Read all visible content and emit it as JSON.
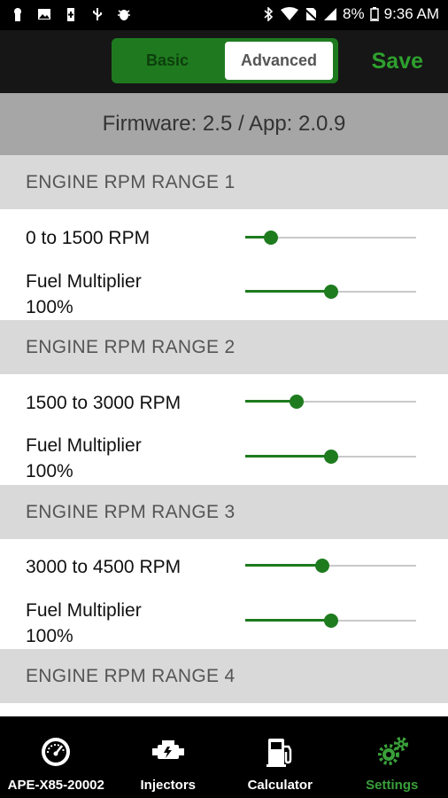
{
  "status_bar": {
    "battery": "8%",
    "time": "9:36 AM"
  },
  "toolbar": {
    "toggle_basic": "Basic",
    "toggle_advanced": "Advanced",
    "selected_mode": "Advanced",
    "save_label": "Save"
  },
  "firmware_text": "Firmware: 2.5 / App: 2.0.9",
  "sections": [
    {
      "header": "ENGINE RPM RANGE 1",
      "range_label": "0 to 1500 RPM",
      "range_slider_fraction": 0.15,
      "multiplier_label_line1": "Fuel Multiplier",
      "multiplier_value": "100%",
      "multiplier_slider_fraction": 0.5
    },
    {
      "header": "ENGINE RPM RANGE 2",
      "range_label": "1500 to 3000 RPM",
      "range_slider_fraction": 0.3,
      "multiplier_label_line1": "Fuel Multiplier",
      "multiplier_value": "100%",
      "multiplier_slider_fraction": 0.5
    },
    {
      "header": "ENGINE RPM RANGE 3",
      "range_label": "3000 to 4500 RPM",
      "range_slider_fraction": 0.45,
      "multiplier_label_line1": "Fuel Multiplier",
      "multiplier_value": "100%",
      "multiplier_slider_fraction": 0.5
    },
    {
      "header": "ENGINE RPM RANGE 4"
    }
  ],
  "colors": {
    "accent": "#1e7b1e",
    "save": "#2ea02e",
    "active_tab": "#3aa03a"
  },
  "bottom_nav": [
    {
      "label": "APE-X85-20002",
      "icon": "gauge-icon",
      "active": false
    },
    {
      "label": "Injectors",
      "icon": "injector-icon",
      "active": false
    },
    {
      "label": "Calculator",
      "icon": "fuel-pump-icon",
      "active": false
    },
    {
      "label": "Settings",
      "icon": "gears-icon",
      "active": true
    }
  ]
}
